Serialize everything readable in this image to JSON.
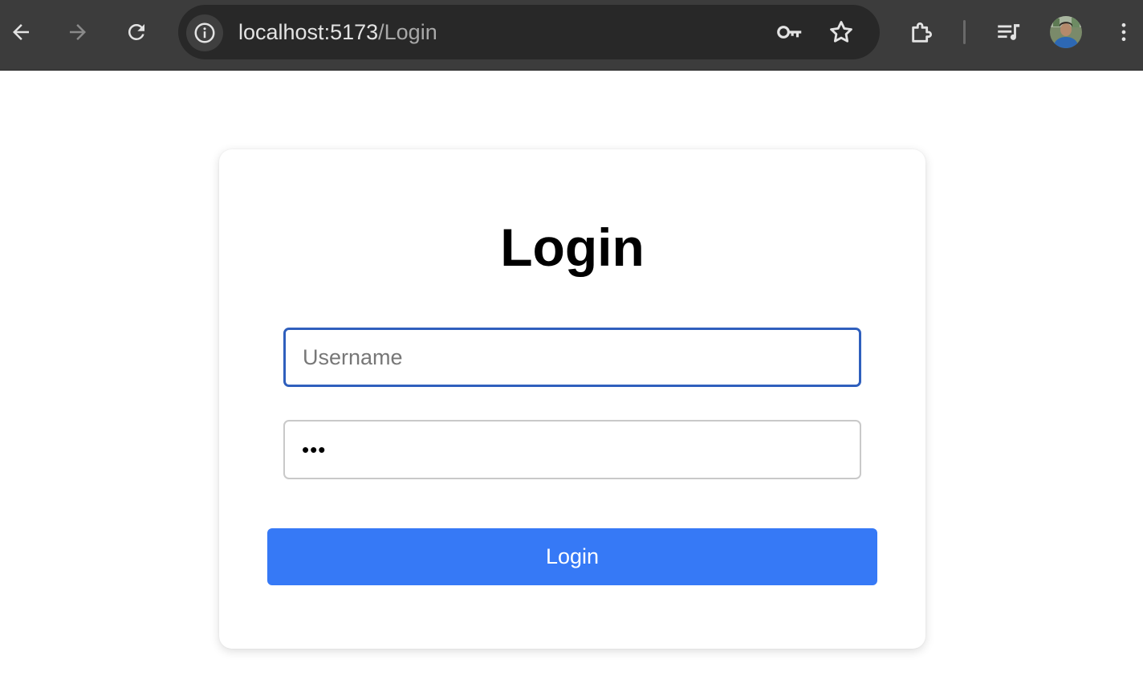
{
  "browser": {
    "url_host": "localhost:5173",
    "url_path": "/Login",
    "icons": {
      "back": "arrow-left-icon",
      "forward": "arrow-right-icon",
      "reload": "reload-icon",
      "site_info": "info-icon",
      "password_key": "key-icon",
      "bookmark": "star-icon",
      "extensions": "puzzle-icon",
      "media": "playlist-icon",
      "avatar": "profile-avatar",
      "menu": "kebab-menu-icon"
    },
    "colors": {
      "toolbar": "#3c3c3c",
      "omnibox": "#282828"
    }
  },
  "login": {
    "title": "Login",
    "username": {
      "placeholder": "Username",
      "value": ""
    },
    "password": {
      "placeholder": "",
      "value": "•••"
    },
    "submit_label": "Login",
    "colors": {
      "button": "#3679f6",
      "focus_border": "#2f5fbd"
    }
  }
}
